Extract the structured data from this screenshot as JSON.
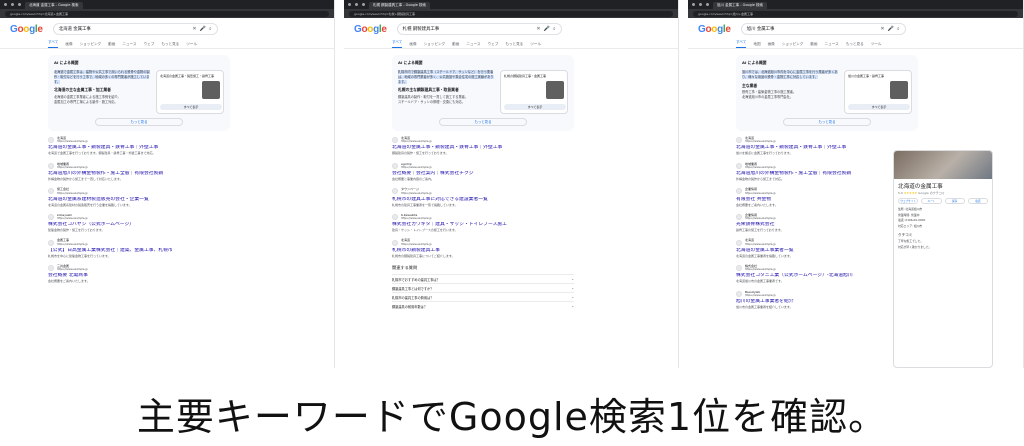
{
  "shots": [
    {
      "tab_title": "北海道 金属工事 - Google 検索",
      "url": "google.com/search?q=北海道+金属工事",
      "query": "北海道 金属工事",
      "tabs": [
        "すべて",
        "画像",
        "ショッピング",
        "動画",
        "ニュース",
        "ウェブ",
        "もっと見る",
        "ツール"
      ],
      "ai_title": "AI による概要",
      "ai_text": "北海道で金属工事は、建物や公共工事で用いられる鉄骨や金物の製作・取付などを行う工事で、地域の多くの専門業者が施工しています。",
      "ai_card": {
        "title": "北海道の金属工事・製缶施工・鉄骨工事",
        "button": "すべて表示"
      },
      "ai_h": "北海道の主な金属工事・加工業者",
      "ai_items": [
        "北海道の金属工事業者による施工事例を紹介。",
        "金属加工の専門工場による製作・施工対応。"
      ],
      "more": "もっと見る",
      "results": [
        {
          "source": "北海道",
          "url": "https://www.example.jp",
          "title": "北海道の金属工事・鋼製建具・鉄骨工事｜外壁工事",
          "snippet": "北海道で金属工事を行っております。鋼製建具・鉄骨工事・外壁工事まで対応。"
        },
        {
          "source": "地域業者",
          "url": "https://www.example.jp",
          "title": "北海道旭川の外構金物製作・施工全般｜有限会社製鋼",
          "snippet": "外構金物の製作から施工まで一貫して対応いたします。"
        },
        {
          "source": "施工会社",
          "url": "https://www.example.jp",
          "title": "北海道の金属系建材製造販売の会社・企業一覧",
          "snippet": "北海道の金属系建材の製造販売を行う企業を掲載しています。"
        },
        {
          "source": "kobayashi",
          "url": "https://www.example.jp",
          "title": "株式会社コバヤシ（公式ホームページ）",
          "snippet": "建築金物の製作・施工を行っております。"
        },
        {
          "source": "金属工事",
          "url": "https://www.example.jp",
          "title": "【公式】日高金属工業株式会社｜建築、金属工事、札幌市",
          "snippet": "札幌市を中心に建築金物工事を行っています。"
        },
        {
          "source": "三共金属",
          "url": "https://www.example.jp",
          "title": "会社概要 北電商事",
          "snippet": "会社概要をご案内いたします。"
        }
      ]
    },
    {
      "tab_title": "札幌 鋼製建具工事 - Google 検索",
      "url": "google.com/search?q=札幌+鋼製建具工事",
      "query": "札幌 鋼製建具工事",
      "tabs": [
        "すべて",
        "画像",
        "ショッピング",
        "動画",
        "ニュース",
        "ウェブ",
        "もっと見る",
        "ツール"
      ],
      "ai_title": "AI による概要",
      "ai_text": "札幌市内で鋼製建具工事（スチールドア、サッシなど）を行う業者は、地域の専門業者が多く、公共施設や集合住宅の施工実績があります。",
      "ai_card": {
        "title": "札幌の鋼製建具工事・金属工事",
        "button": "すべて表示"
      },
      "ai_h": "札幌の主な鋼製建具工事・取扱業者",
      "ai_items": [
        "鋼製建具の製作・取付を一貫して施工する業者。",
        "スチールドア・サッシの修理・交換にも対応。"
      ],
      "more": "もっと見る",
      "results": [
        {
          "source": "北海道",
          "url": "https://www.example.jp",
          "title": "北海道の金属工事・鋼製建具・鉄骨工事｜外壁工事",
          "snippet": "鋼製建具の製作・施工を行っております。"
        },
        {
          "source": "egotrip",
          "url": "https://www.example.jp",
          "title": "会社概要｜会社案内｜株式会社チクジ",
          "snippet": "会社概要と事業内容のご案内。"
        },
        {
          "source": "タウンページ",
          "url": "https://www.example.jp",
          "title": "札幌市の建具工事に対応できる建設業者一覧",
          "snippet": "札幌市の建具工事業者を一覧で掲載しています。"
        },
        {
          "source": "K-Kawakita",
          "url": "https://www.example.jp",
          "title": "株式会社カワキタ｜建具・サッシ・トイレブース施工",
          "snippet": "建具・サッシ・トイレブースの施工を行います。"
        },
        {
          "source": "北海道",
          "url": "https://www.example.jp",
          "title": "札幌市の鋼製建具工事",
          "snippet": "札幌市の鋼製建具工事についてご紹介します。"
        }
      ],
      "paa_h": "関連する質問",
      "paa": [
        "札幌市でおすすめの建具工事は？",
        "鋼製建具工事とは何ですか？",
        "札幌市の建具工事の費用は？",
        "鋼製建具の耐用年数は？"
      ]
    },
    {
      "tab_title": "旭川 金属工事 - Google 検索",
      "url": "google.com/search?q=旭川+金属工事",
      "query": "旭川 金属工事",
      "tabs": [
        "すべて",
        "地図",
        "画像",
        "ショッピング",
        "動画",
        "ニュース",
        "もっと見る",
        "ツール"
      ],
      "ai_title": "AI による概要",
      "ai_text": "旭川市では、北海道旭川市内を中心に金属工事を行う業者が多くあり、様々な用途の鉄骨・金物工事に対応しています。",
      "ai_card": {
        "title": "旭川の金属工事・鉄骨工事",
        "button": "すべて表示"
      },
      "ai_h": "主な業者",
      "ai_items": [
        "鉄骨工事・建築金物工事の施工業者。",
        "北海道旭川市の金属工事専門会社。"
      ],
      "more": "もっと見る",
      "results": [
        {
          "source": "北海道",
          "url": "https://www.example.jp",
          "title": "北海道の金属工事・鋼製建具・鉄骨工事｜外壁工事",
          "snippet": "旭川を拠点に金属工事を行っております。"
        },
        {
          "source": "地域業者",
          "url": "https://www.example.jp",
          "title": "北海道旭川の外構金物製作・施工全般｜有限会社製鋼",
          "snippet": "外構金物の製作から施工まで対応。"
        },
        {
          "source": "企業情報",
          "url": "https://www.example.jp",
          "title": "有限会社 共金物",
          "snippet": "会社概要をご案内いたします。"
        },
        {
          "source": "企業情報",
          "url": "https://www.example.jp",
          "title": "光栄鉄骨株式会社",
          "snippet": "鉄骨工事の施工を行っております。"
        },
        {
          "source": "北海道",
          "url": "https://www.example.jp",
          "title": "北海道の金属工事業者一覧",
          "snippet": "北海道の金属工事業者を掲載しています。"
        },
        {
          "source": "株式会社",
          "url": "https://www.example.jp",
          "title": "株式会社コタニ工業（公式ホームページ）-北海道旭川",
          "snippet": "北海道旭川市の金属工事業者です。"
        },
        {
          "source": "Beautylab",
          "url": "https://www.example.jp",
          "title": "旭川の金属工事業者を紹介",
          "snippet": "旭川市の金属工事業者を紹介しています。"
        }
      ],
      "kp": {
        "name": "北海道の金属工事",
        "rating": "5.0",
        "stars": "★★★★★",
        "reviews": "Google のクチコミ",
        "buttons": [
          "ウェブサイト",
          "ルート",
          "保存",
          "電話"
        ],
        "rows": [
          "住所: 北海道旭川市",
          "営業時間: 営業中",
          "電話: 0166-00-0000",
          "対応エリア: 旭川市"
        ],
        "section": "クチコミ",
        "review_items": [
          "丁寧な施工でした。",
          "対応が早く助かりました。"
        ]
      }
    }
  ],
  "caption": "主要キーワードでGoogle検索1位を確認。",
  "logo": {
    "text": "Google",
    "colors": [
      "#4285F4",
      "#EA4335",
      "#FBBC05",
      "#4285F4",
      "#34A853",
      "#EA4335"
    ]
  }
}
